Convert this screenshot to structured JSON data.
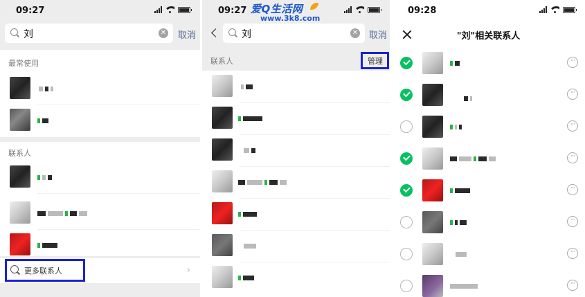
{
  "panel1": {
    "time": "09:27",
    "search": {
      "query": "刘",
      "cancel_label": "取消"
    },
    "section_recent": "最常使用",
    "section_contacts": "联系人",
    "more_contacts": "更多联系人"
  },
  "panel2": {
    "time": "09:27",
    "search": {
      "query": "刘",
      "cancel_label": "取消"
    },
    "section_contacts": "联系人",
    "manage_label": "管理"
  },
  "panel3": {
    "time": "09:28",
    "title": "\"刘\"相关联系人",
    "items": [
      {
        "checked": true
      },
      {
        "checked": true
      },
      {
        "checked": false
      },
      {
        "checked": true
      },
      {
        "checked": true
      },
      {
        "checked": false
      },
      {
        "checked": false
      },
      {
        "checked": false
      }
    ]
  },
  "watermark": {
    "main": "爱Q生活网",
    "sub": "www.3k8.com"
  },
  "colors": {
    "accent_green": "#07c160",
    "link_blue": "#576b95",
    "highlight": "#1a22d6"
  }
}
